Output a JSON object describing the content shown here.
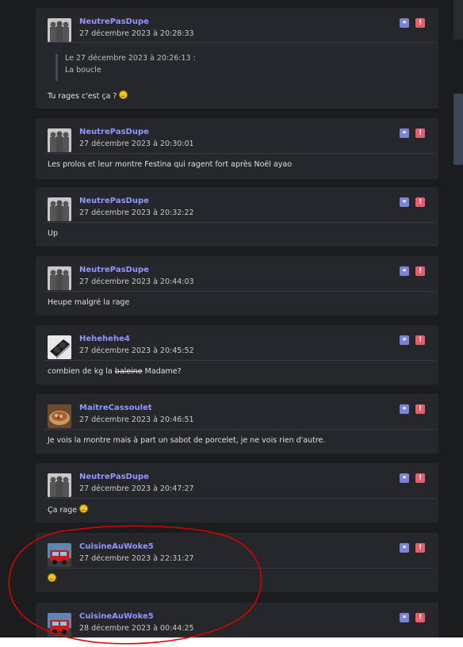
{
  "posts": [
    {
      "author": "NeutrePasDupe",
      "date": "27 décembre 2023 à 20:28:33",
      "avatar": "shadow-figures",
      "quote": {
        "header": "Le 27 décembre 2023 à 20:26:13 :",
        "text": "La boucle"
      },
      "text": "Tu rages c'est ça ?",
      "smiley": true
    },
    {
      "author": "NeutrePasDupe",
      "date": "27 décembre 2023 à 20:30:01",
      "avatar": "shadow-figures",
      "text": "Les prolos et leur montre Festina qui ragent fort après Noël ayao"
    },
    {
      "author": "NeutrePasDupe",
      "date": "27 décembre 2023 à 20:32:22",
      "avatar": "shadow-figures",
      "text": "Up"
    },
    {
      "author": "NeutrePasDupe",
      "date": "27 décembre 2023 à 20:44:03",
      "avatar": "shadow-figures",
      "text": "Heupe malgré la rage"
    },
    {
      "author": "Hehehehe4",
      "date": "27 décembre 2023 à 20:45:52",
      "avatar": "graphics-card",
      "text_before": "combien de kg la",
      "text_struck": "baleine",
      "text_after": "Madame?"
    },
    {
      "author": "MaitreCassoulet",
      "date": "27 décembre 2023 à 20:46:51",
      "avatar": "cassoulet-dish",
      "text": "Je vois la montre mais à part un sabot de porcelet, je ne vois rien d'autre."
    },
    {
      "author": "NeutrePasDupe",
      "date": "27 décembre 2023 à 20:47:27",
      "avatar": "shadow-figures",
      "text": "Ça rage",
      "smiley": true
    },
    {
      "author": "CuisineAuWoke5",
      "date": "27 décembre 2023 à 22:31:27",
      "avatar": "red-truck",
      "text": "",
      "smiley": true
    },
    {
      "author": "CuisineAuWoke5",
      "date": "28 décembre 2023 à 00:44:25",
      "avatar": "red-truck"
    }
  ],
  "icons": {
    "link": "link-icon",
    "report": "report-icon"
  },
  "colors": {
    "author": "#8f97ff",
    "link_button": "#7b83d6",
    "report_button": "#e75c6e",
    "annotation": "#d90000"
  },
  "report_glyph": "!"
}
